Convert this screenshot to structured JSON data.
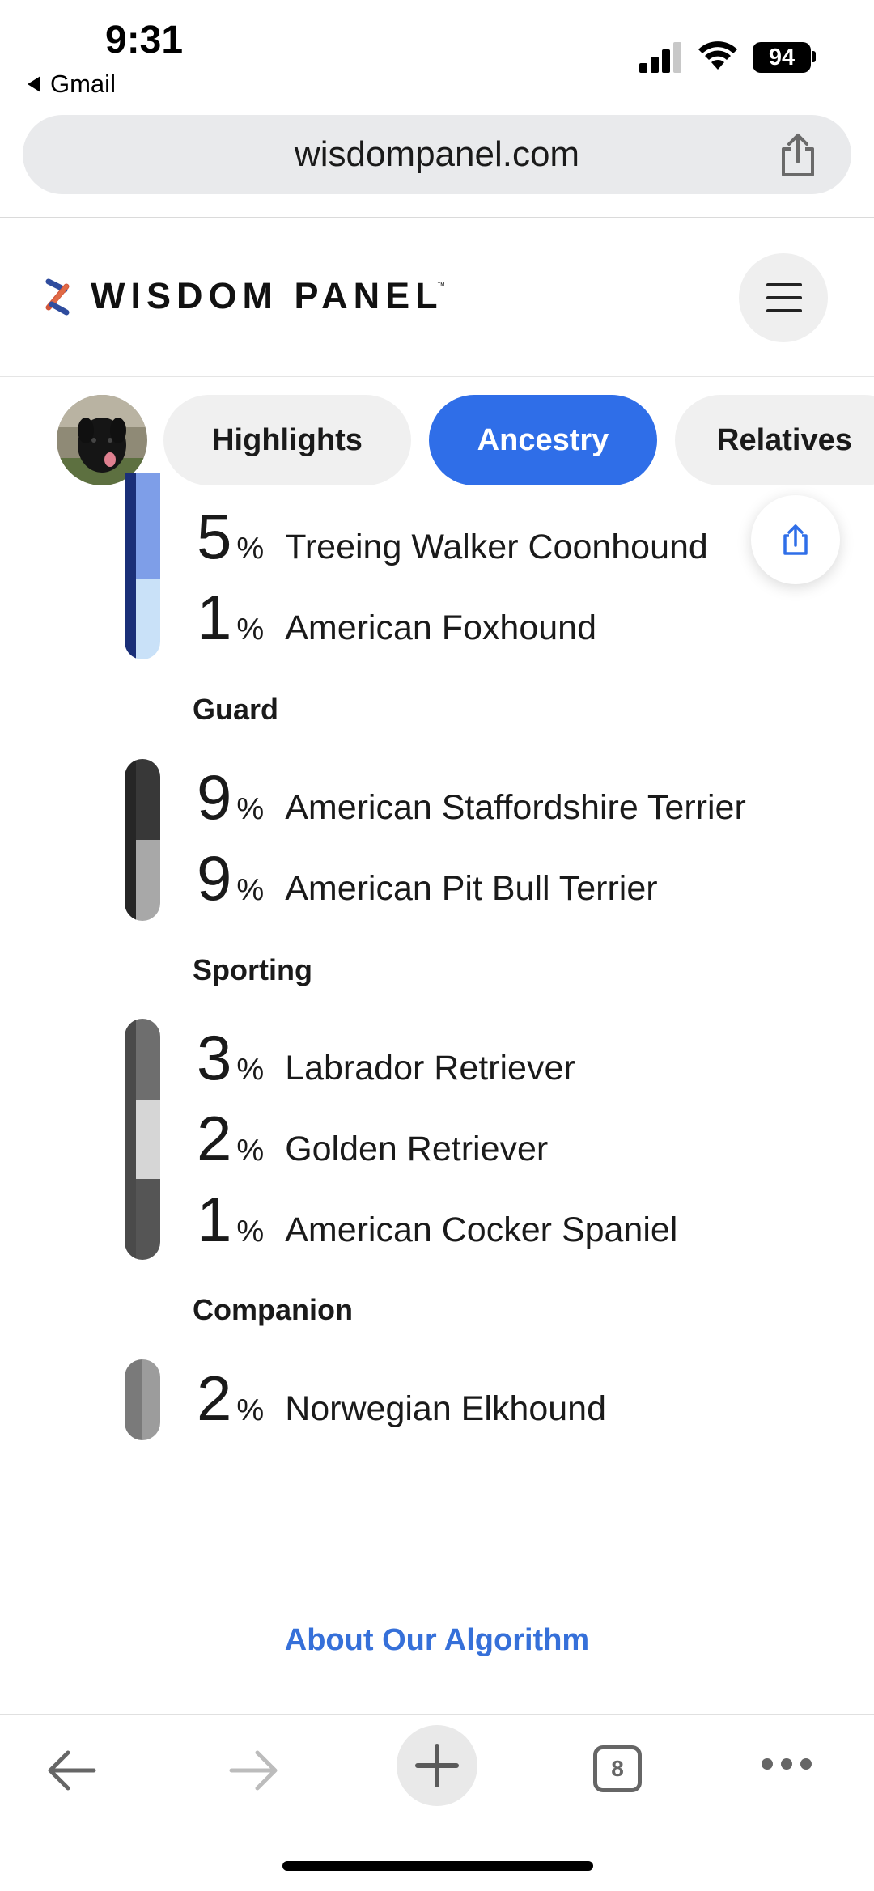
{
  "status_bar": {
    "time": "9:31",
    "back_app": "Gmail",
    "battery": "94"
  },
  "browser": {
    "url": "wisdompanel.com",
    "tab_count": "8"
  },
  "site": {
    "brand": "WISDOM PANEL",
    "trademark": "™"
  },
  "tabs": [
    {
      "label": "Highlights",
      "active": false
    },
    {
      "label": "Ancestry",
      "active": true
    },
    {
      "label": "Relatives",
      "active": false
    }
  ],
  "ancestry": {
    "hound_partial": [
      {
        "pct": "5",
        "sign": "%",
        "breed": "Treeing Walker Coonhound"
      },
      {
        "pct": "1",
        "sign": "%",
        "breed": "American Foxhound"
      }
    ],
    "guard": {
      "title": "Guard",
      "items": [
        {
          "pct": "9",
          "sign": "%",
          "breed": "American Staffordshire Terrier"
        },
        {
          "pct": "9",
          "sign": "%",
          "breed": "American Pit Bull Terrier"
        }
      ]
    },
    "sporting": {
      "title": "Sporting",
      "items": [
        {
          "pct": "3",
          "sign": "%",
          "breed": "Labrador Retriever"
        },
        {
          "pct": "2",
          "sign": "%",
          "breed": "Golden Retriever"
        },
        {
          "pct": "1",
          "sign": "%",
          "breed": "American Cocker Spaniel"
        }
      ]
    },
    "companion": {
      "title": "Companion",
      "items": [
        {
          "pct": "2",
          "sign": "%",
          "breed": "Norwegian Elkhound"
        }
      ]
    }
  },
  "algorithm_link": "About Our Algorithm",
  "colors": {
    "accent": "#2f6ee8",
    "link": "#3670d9",
    "hound_dark": "#1a2f78",
    "hound_mid": "#7e9ee8",
    "hound_light": "#c9e1f8",
    "guard_dark": "#383838",
    "guard_light": "#a8a8a8",
    "sporting_dark": "#555555",
    "sporting_light": "#d6d6d6",
    "companion": "#9c9c9c"
  },
  "icons": [
    "share-icon",
    "logo-mark",
    "menu-icon",
    "dog-avatar",
    "back-arrow-icon",
    "forward-arrow-icon",
    "plus-icon",
    "tabs-icon",
    "more-icon"
  ]
}
